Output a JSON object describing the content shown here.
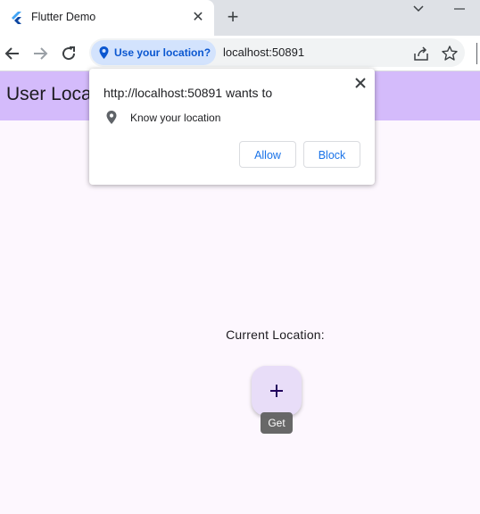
{
  "tab": {
    "title": "Flutter Demo",
    "favicon": "flutter-logo-icon",
    "close": "close-icon"
  },
  "toolbar": {
    "permission_chip": "Use your location?",
    "url": "localhost:50891"
  },
  "app": {
    "title": "User Loca",
    "current_location_label": "Current Location:",
    "fab_tooltip": "Get",
    "fab_icon": "plus-icon"
  },
  "permission_popup": {
    "title": "http://localhost:50891 wants to",
    "permission": "Know your location",
    "allow_label": "Allow",
    "block_label": "Block"
  },
  "colors": {
    "appbar": "#d4bbfb",
    "background": "#fdf7fe",
    "fab": "#e8ddf8",
    "chip": "#d3e3fd",
    "link_blue": "#1a73e8"
  }
}
